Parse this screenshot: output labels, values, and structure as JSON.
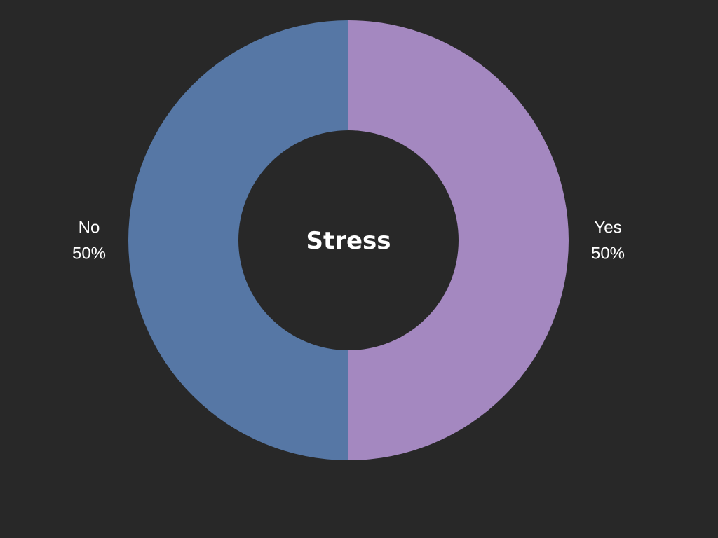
{
  "chart_data": {
    "type": "pie",
    "title": "Stress",
    "categories": [
      "Yes",
      "No"
    ],
    "values": [
      50,
      50
    ],
    "labels": [
      "Yes\n50%",
      "No\n50%"
    ],
    "colors": {
      "background": "#282828",
      "Yes": "#a488c0",
      "No": "#5677a5",
      "text": "#ffffff"
    },
    "donut": true,
    "legend": "none"
  }
}
